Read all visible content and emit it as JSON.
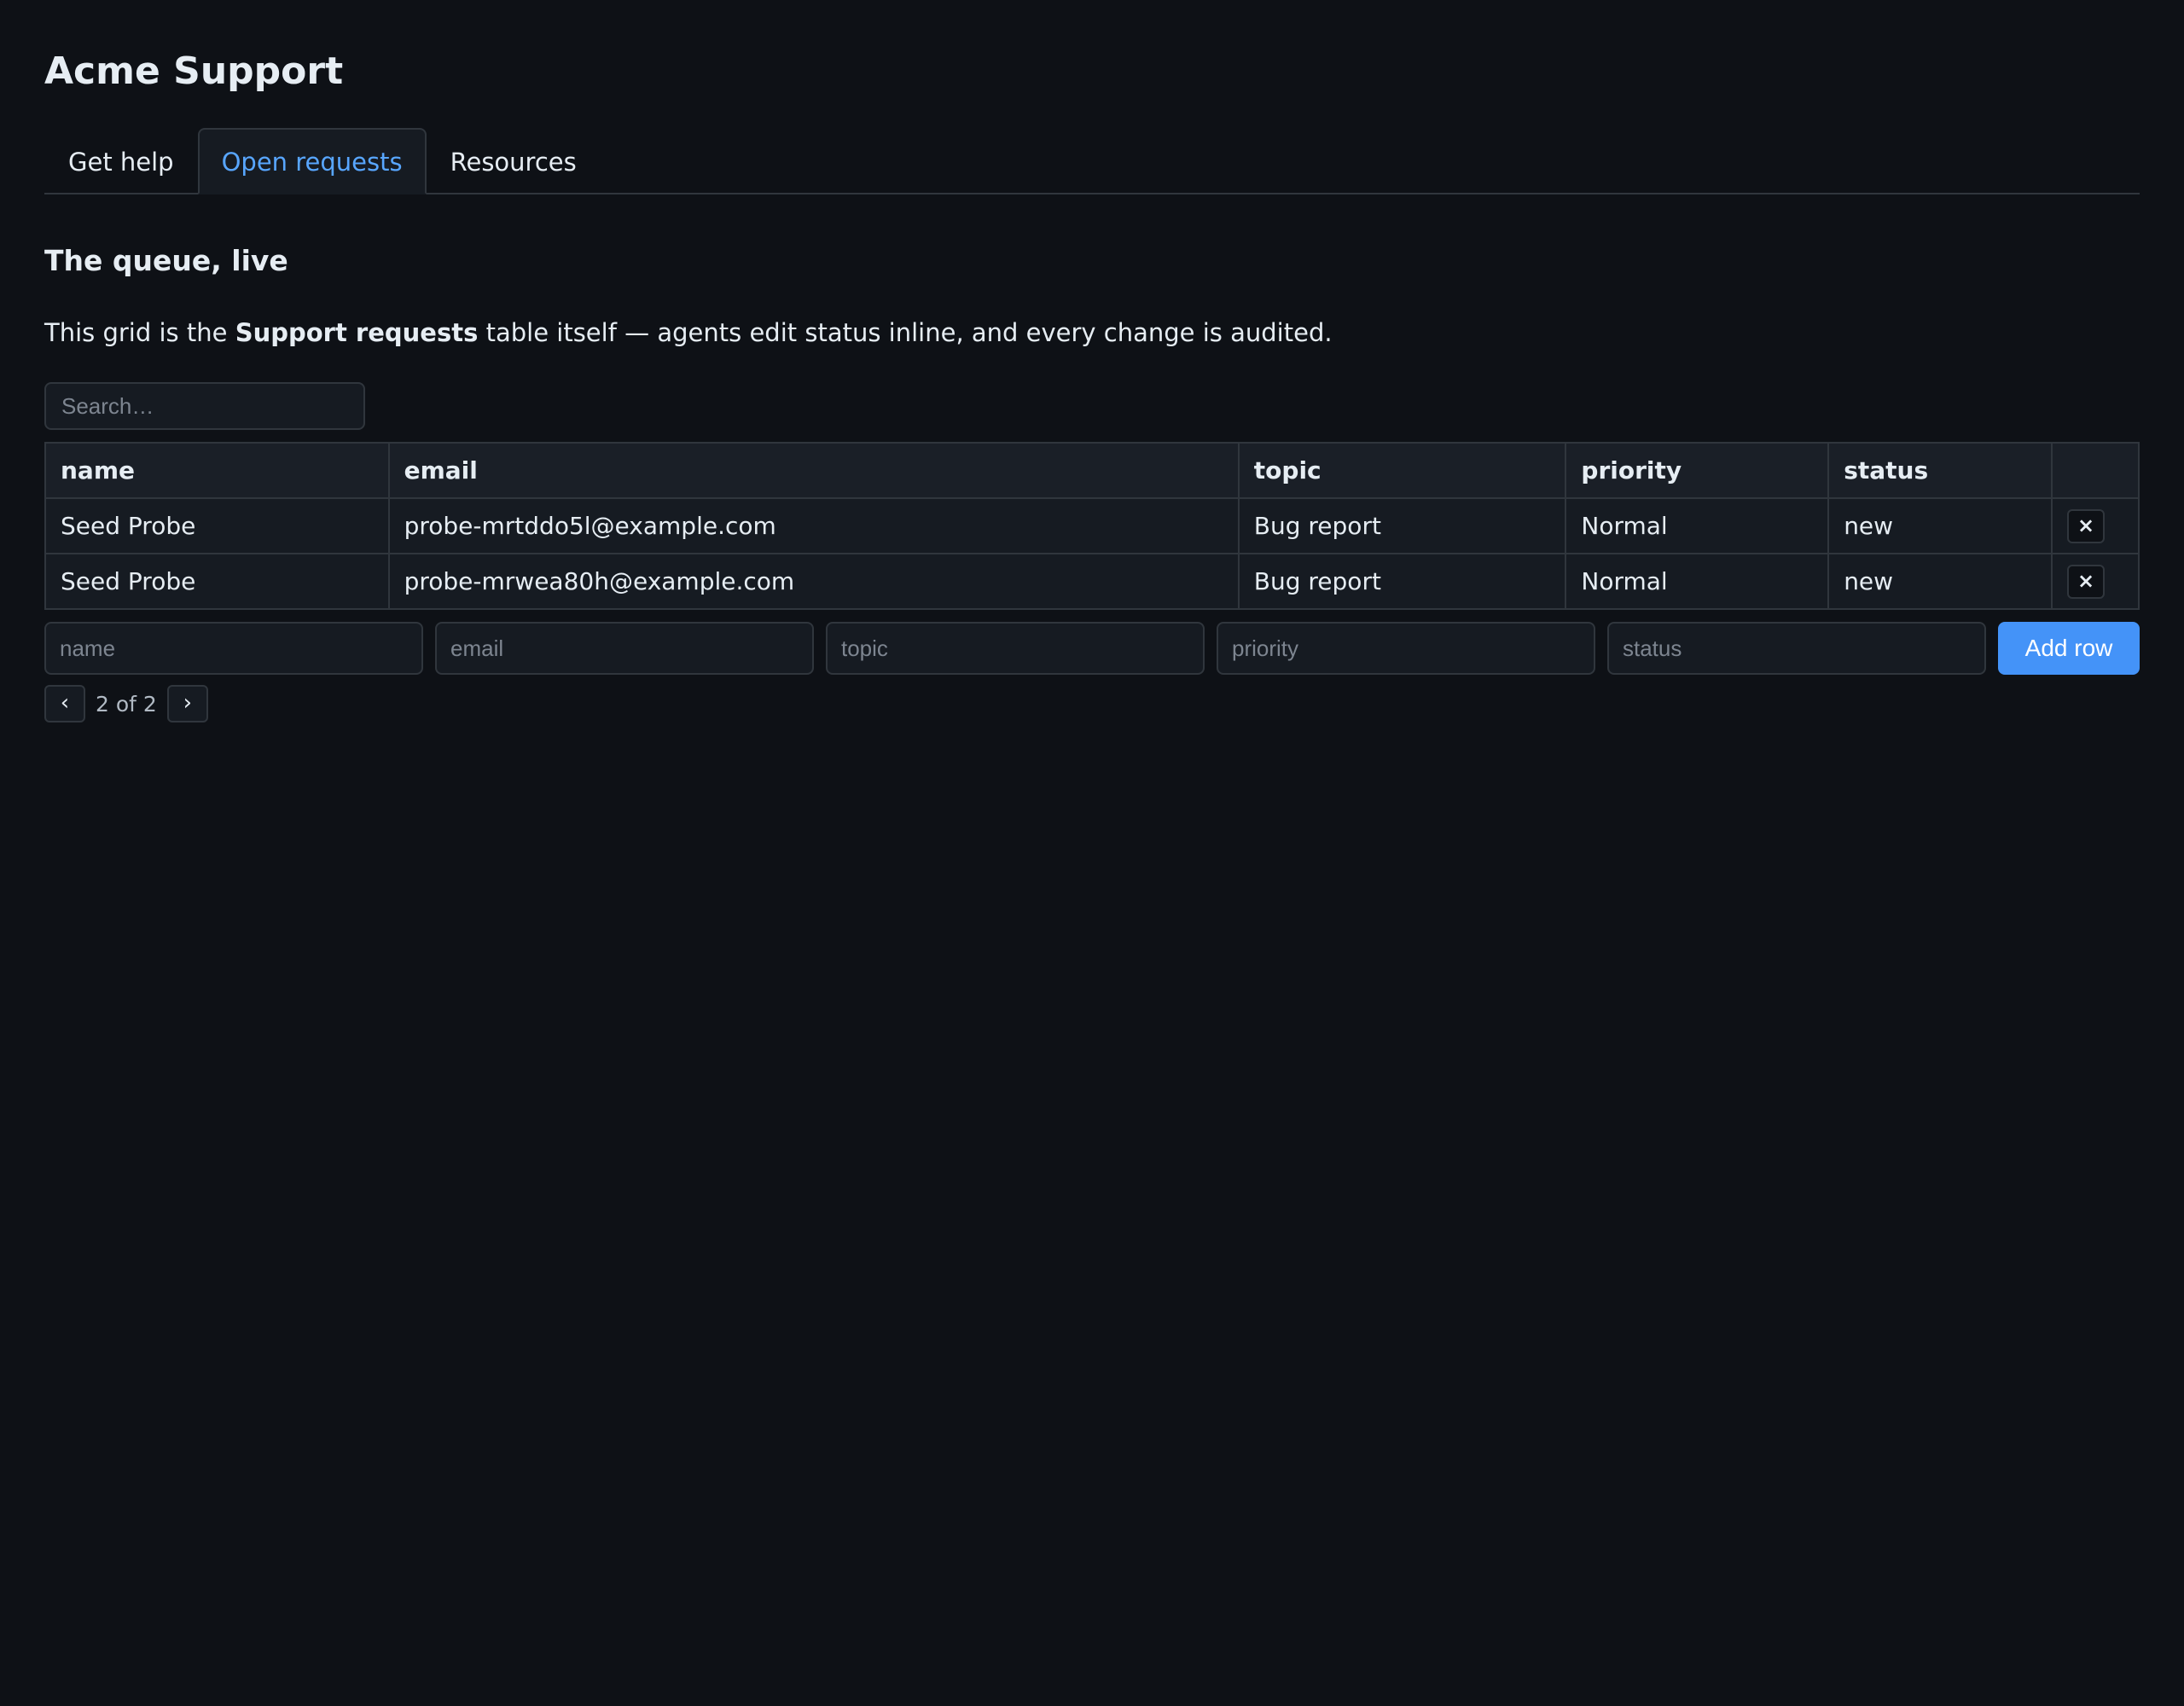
{
  "app": {
    "title": "Acme Support"
  },
  "tabs": [
    {
      "label": "Get help",
      "active": false
    },
    {
      "label": "Open requests",
      "active": true
    },
    {
      "label": "Resources",
      "active": false
    }
  ],
  "section": {
    "title": "The queue, live",
    "desc_before": "This grid is the ",
    "desc_bold": "Support requests",
    "desc_after": " table itself — agents edit status inline, and every change is audited."
  },
  "search": {
    "placeholder": "Search…"
  },
  "table": {
    "columns": [
      "name",
      "email",
      "topic",
      "priority",
      "status"
    ],
    "rows": [
      {
        "name": "Seed Probe",
        "email": "probe-mrtddo5l@example.com",
        "topic": "Bug report",
        "priority": "Normal",
        "status": "new"
      },
      {
        "name": "Seed Probe",
        "email": "probe-mrwea80h@example.com",
        "topic": "Bug report",
        "priority": "Normal",
        "status": "new"
      }
    ],
    "delete_label": "×"
  },
  "add_row": {
    "placeholders": {
      "name": "name",
      "email": "email",
      "topic": "topic",
      "priority": "priority",
      "status": "status"
    },
    "button_label": "Add row"
  },
  "pager": {
    "prev": "‹",
    "label": "2 of 2",
    "next": "›"
  },
  "colors": {
    "accent": "#4493f8",
    "background": "#0e1116",
    "surface": "#161b22",
    "border": "#30363d"
  }
}
